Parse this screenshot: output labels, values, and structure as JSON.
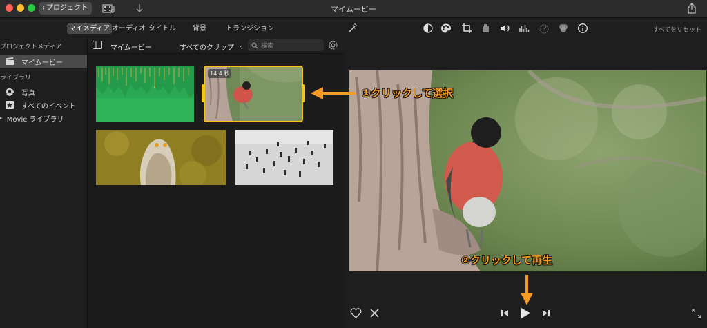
{
  "window": {
    "title": "マイムービー",
    "back_label": "プロジェクト"
  },
  "toolbar": {
    "tabs": [
      "マイメディア",
      "オーディオ",
      "タイトル",
      "背景",
      "トランジション"
    ],
    "reset_all": "すべてをリセット"
  },
  "sidebar": {
    "project_media_header": "プロジェクトメディア",
    "project_item": "マイムービー",
    "library_header": "ライブラリ",
    "photos": "写真",
    "all_events": "すべてのイベント",
    "imovie_library": "iMovie ライブラリ"
  },
  "browser": {
    "title": "マイムービー",
    "filter": "すべてのクリップ",
    "search_placeholder": "検索",
    "selected_clip_duration": "14.4 秒"
  },
  "annotations": {
    "select": "①クリックして選択",
    "play": "②クリックして再生"
  },
  "colors": {
    "accent_yellow": "#f5c518",
    "callout_orange": "#f59a23",
    "audio_green": "#2db45a"
  }
}
